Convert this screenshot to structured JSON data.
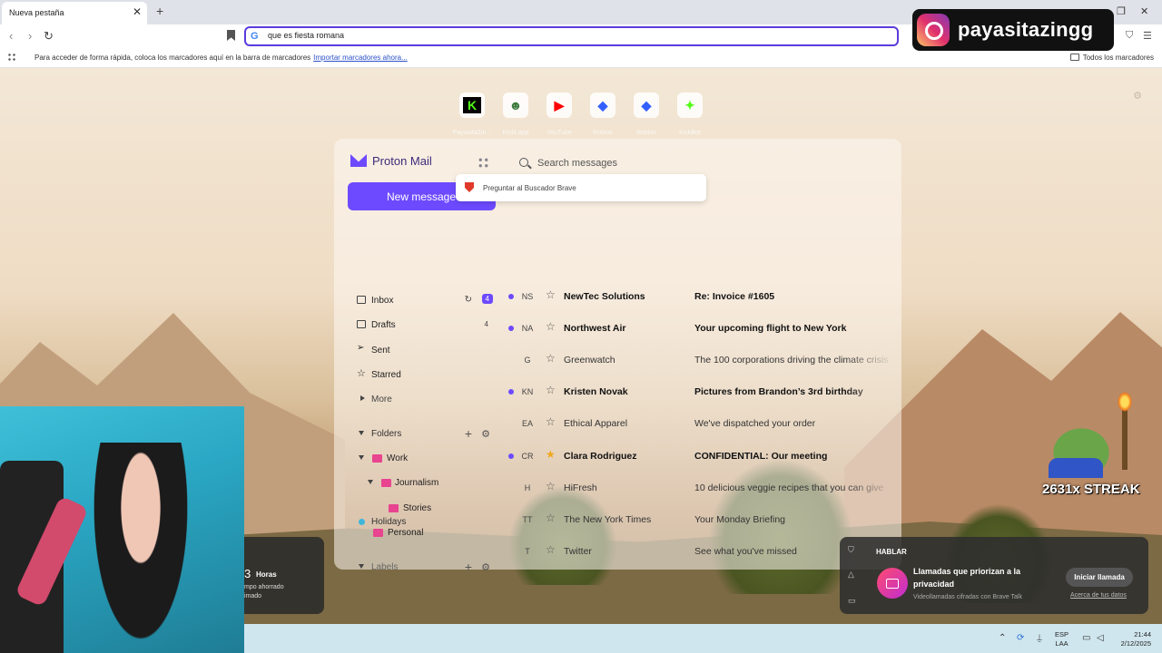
{
  "browser": {
    "tab_title": "Nueva pestaña",
    "close_glyph": "✕",
    "new_tab_glyph": "+",
    "window_controls": [
      "—",
      "❐",
      "✕"
    ],
    "nav": {
      "back": "‹",
      "forward": "›",
      "reload": "↻"
    },
    "url": "que es fiesta romana",
    "bookmarks_hint": "Para acceder de forma rápida, coloca los marcadores aquí en la barra de marcadores",
    "bookmarks_import": "Importar marcadores ahora...",
    "all_bookmarks": "Todos los marcadores"
  },
  "speed_dial": [
    {
      "label": "PayasitaZin...",
      "glyph": "K",
      "icon": "kick-icon",
      "color": "#53fc18"
    },
    {
      "label": "KickLapp",
      "glyph": "☻",
      "icon": "frog-icon",
      "color": "#3c7a3c"
    },
    {
      "label": "YouTube",
      "glyph": "▶",
      "icon": "youtube-icon",
      "color": "#ff0000"
    },
    {
      "label": "Roblox",
      "glyph": "◆",
      "icon": "roblox-icon",
      "color": "#335fff"
    },
    {
      "label": "Roblox",
      "glyph": "◆",
      "icon": "roblox-icon",
      "color": "#335fff"
    },
    {
      "label": "KickBot",
      "glyph": "✦",
      "icon": "kickbot-icon",
      "color": "#53fc18"
    }
  ],
  "search_suggestion": "Preguntar al Buscador Brave",
  "proton": {
    "brand": "Proton Mail",
    "search_placeholder": "Search messages",
    "new_message": "New message",
    "nav": [
      {
        "label": "Inbox",
        "count": "4",
        "badge": true
      },
      {
        "label": "Drafts",
        "count": "4",
        "badge": false
      },
      {
        "label": "Sent",
        "count": "",
        "badge": false
      },
      {
        "label": "Starred",
        "count": "",
        "badge": false
      }
    ],
    "more": "More",
    "folders_title": "Folders",
    "folders": [
      "Work",
      "Journalism",
      "Stories",
      "Personal"
    ],
    "labels_title": "Labels",
    "labels": [
      "Holidays"
    ],
    "messages": [
      {
        "initials": "NS",
        "sender": "NewTec Solutions",
        "subject": "Re: Invoice #1605",
        "unread": true,
        "starred": false
      },
      {
        "initials": "NA",
        "sender": "Northwest Air",
        "subject": "Your upcoming flight to New York",
        "unread": true,
        "starred": false
      },
      {
        "initials": "G",
        "sender": "Greenwatch",
        "subject": "The 100 corporations driving the climate crisis",
        "unread": false,
        "starred": false
      },
      {
        "initials": "KN",
        "sender": "Kristen Novak",
        "subject": "Pictures from Brandon’s 3rd birthday",
        "unread": true,
        "starred": false
      },
      {
        "initials": "EA",
        "sender": "Ethical Apparel",
        "subject": "We've dispatched your order",
        "unread": false,
        "starred": false
      },
      {
        "initials": "CR",
        "sender": "Clara Rodriguez",
        "subject": "CONFIDENTIAL: Our meeting",
        "unread": true,
        "starred": true
      },
      {
        "initials": "H",
        "sender": "HiFresh",
        "subject": "10 delicious veggie recipes that you can give",
        "unread": false,
        "starred": false
      },
      {
        "initials": "TT",
        "sender": "The New York Times",
        "subject": "Your Monday Briefing",
        "unread": false,
        "starred": false
      },
      {
        "initials": "T",
        "sender": "Twitter",
        "subject": "See what you've missed",
        "unread": false,
        "starred": false
      }
    ]
  },
  "time_widget": {
    "number": "3",
    "unit": "Horas",
    "line1": "mpo ahorrado",
    "line2": "imado"
  },
  "talk": {
    "title": "HABLAR",
    "heading": "Llamadas que priorizan a la privacidad",
    "description": "Videollamadas cifradas con Brave Talk",
    "button": "Iniciar llamada",
    "link": "Acerca de tus datos"
  },
  "overlay": {
    "instagram_handle": "payasitazingg",
    "streak": "2631x STREAK"
  },
  "taskbar": {
    "lang1": "ESP",
    "lang2": "LAA",
    "time": "21:44",
    "date": "2/12/2025"
  },
  "colors": {
    "accent": "#6d4aff",
    "url_border": "#5b3bdc",
    "star": "#f1a81c"
  }
}
